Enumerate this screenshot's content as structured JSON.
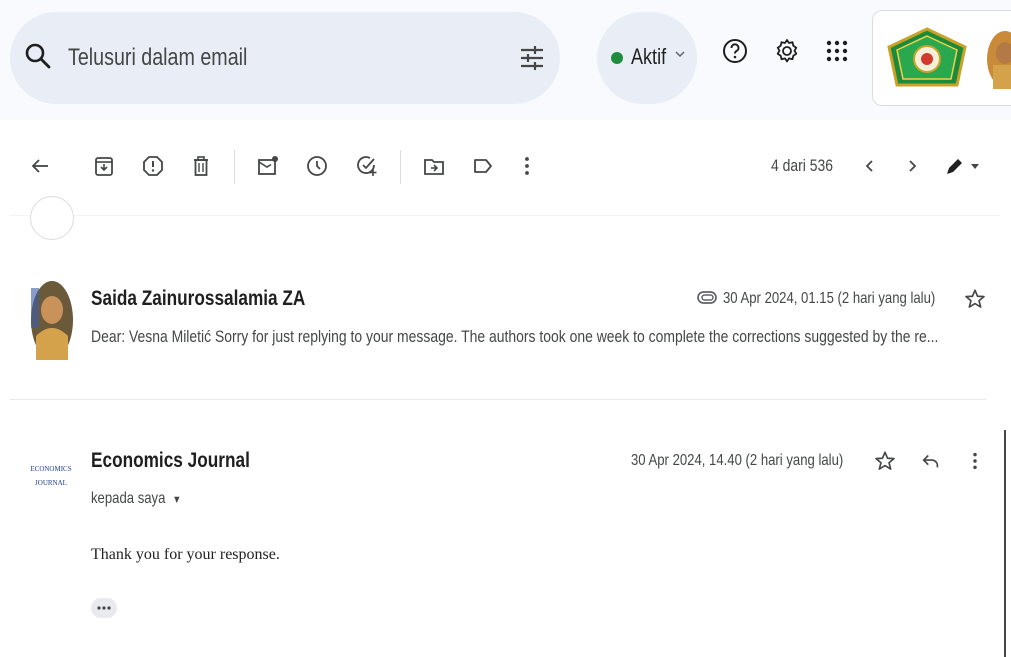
{
  "search": {
    "placeholder": "Telusuri dalam email"
  },
  "status": {
    "label": "Aktif",
    "color": "#1e8e3e"
  },
  "toolbar": {
    "page_count": "4 dari 536"
  },
  "messages": [
    {
      "sender": "Saida Zainurossalamia ZA",
      "date": "30 Apr 2024, 01.15 (2 hari yang lalu)",
      "snippet": "Dear: Vesna Miletić Sorry for just replying to your message. The authors took one week to complete the corrections suggested by the re..."
    },
    {
      "sender": "Economics Journal",
      "date": "30 Apr 2024, 14.40 (2 hari yang lalu)",
      "recipient": "kepada saya",
      "body": "Thank you for your response.",
      "logo_text_line1": "ECONOMICS",
      "logo_text_line2": "JOURNAL"
    }
  ],
  "icons": {
    "search": "search-icon",
    "tune": "tune-icon",
    "help": "help-icon",
    "settings": "gear-icon",
    "apps": "apps-grid-icon",
    "back": "arrow-back-icon",
    "archive": "archive-icon",
    "spam": "report-spam-icon",
    "delete": "trash-icon",
    "unread": "mark-unread-icon",
    "snooze": "clock-icon",
    "task": "add-task-icon",
    "move": "move-to-icon",
    "label": "label-icon",
    "more": "more-vert-icon",
    "prev": "chevron-left-icon",
    "next": "chevron-right-icon",
    "pen": "pen-icon",
    "star": "star-icon",
    "reply": "reply-icon"
  },
  "colors": {
    "topbar_bg": "#f8fafd",
    "search_bg": "#e9eef6",
    "logo_green": "#1b8a3a"
  }
}
